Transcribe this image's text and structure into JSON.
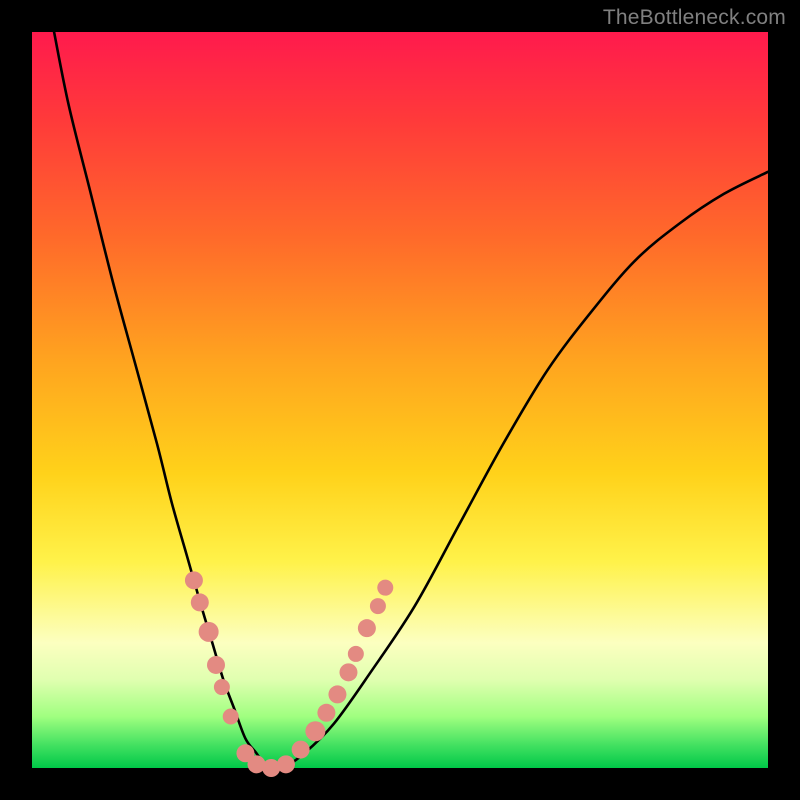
{
  "watermark": "TheBottleneck.com",
  "chart_data": {
    "type": "line",
    "title": "",
    "xlabel": "",
    "ylabel": "",
    "xlim": [
      0,
      100
    ],
    "ylim": [
      0,
      100
    ],
    "series": [
      {
        "name": "bottleneck-curve",
        "x": [
          3,
          5,
          8,
          11,
          14,
          17,
          19,
          21,
          23,
          24.5,
          26,
          27.5,
          29,
          30.5,
          32,
          34,
          37,
          41,
          46,
          52,
          58,
          64,
          70,
          76,
          82,
          88,
          94,
          100
        ],
        "y": [
          100,
          90,
          78,
          66,
          55,
          44,
          36,
          29,
          22,
          17,
          12,
          8,
          4,
          2,
          0,
          0,
          2,
          6,
          13,
          22,
          33,
          44,
          54,
          62,
          69,
          74,
          78,
          81
        ]
      }
    ],
    "markers": {
      "name": "highlight-dots",
      "color": "#e38a82",
      "points": [
        {
          "x": 22.0,
          "y": 25.5,
          "r": 9
        },
        {
          "x": 22.8,
          "y": 22.5,
          "r": 9
        },
        {
          "x": 24.0,
          "y": 18.5,
          "r": 10
        },
        {
          "x": 25.0,
          "y": 14.0,
          "r": 9
        },
        {
          "x": 25.8,
          "y": 11.0,
          "r": 8
        },
        {
          "x": 27.0,
          "y": 7.0,
          "r": 8
        },
        {
          "x": 29.0,
          "y": 2.0,
          "r": 9
        },
        {
          "x": 30.5,
          "y": 0.5,
          "r": 9
        },
        {
          "x": 32.5,
          "y": 0.0,
          "r": 9
        },
        {
          "x": 34.5,
          "y": 0.5,
          "r": 9
        },
        {
          "x": 36.5,
          "y": 2.5,
          "r": 9
        },
        {
          "x": 38.5,
          "y": 5.0,
          "r": 10
        },
        {
          "x": 40.0,
          "y": 7.5,
          "r": 9
        },
        {
          "x": 41.5,
          "y": 10.0,
          "r": 9
        },
        {
          "x": 43.0,
          "y": 13.0,
          "r": 9
        },
        {
          "x": 44.0,
          "y": 15.5,
          "r": 8
        },
        {
          "x": 45.5,
          "y": 19.0,
          "r": 9
        },
        {
          "x": 47.0,
          "y": 22.0,
          "r": 8
        },
        {
          "x": 48.0,
          "y": 24.5,
          "r": 8
        }
      ]
    }
  }
}
